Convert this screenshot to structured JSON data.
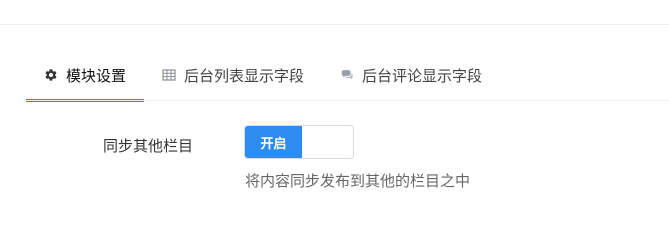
{
  "tabs": [
    {
      "label": "模块设置",
      "icon": "gear-icon",
      "active": true
    },
    {
      "label": "后台列表显示字段",
      "icon": "table-icon",
      "active": false
    },
    {
      "label": "后台评论显示字段",
      "icon": "comments-icon",
      "active": false
    }
  ],
  "form": {
    "sync_label": "同步其他栏目",
    "switch_on_text": "开启",
    "help_text": "将内容同步发布到其他的栏目之中"
  },
  "colors": {
    "accent": "#2d8cf0"
  }
}
